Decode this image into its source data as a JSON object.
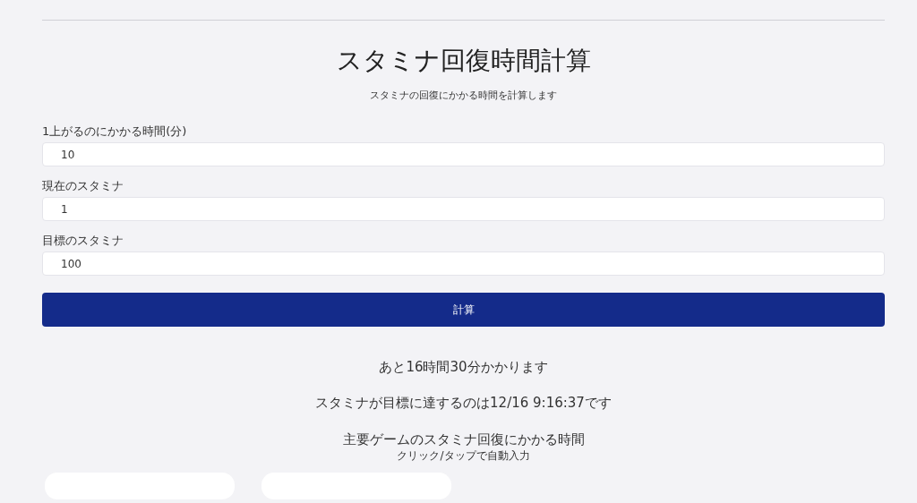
{
  "title": "スタミナ回復時間計算",
  "subtitle": "スタミナの回復にかかる時間を計算します",
  "fields": [
    {
      "label": "1上がるのにかかる時間(分)",
      "value": "10"
    },
    {
      "label": "現在のスタミナ",
      "value": "1"
    },
    {
      "label": "目標のスタミナ",
      "value": "100"
    }
  ],
  "calculate_button": "計算",
  "results": [
    "あと16時間30分かかります",
    "スタミナが目標に達するのは12/16 9:16:37です"
  ],
  "presets": {
    "heading": "主要ゲームのスタミナ回復にかかる時間",
    "hint": "クリック/タップで自動入力"
  }
}
